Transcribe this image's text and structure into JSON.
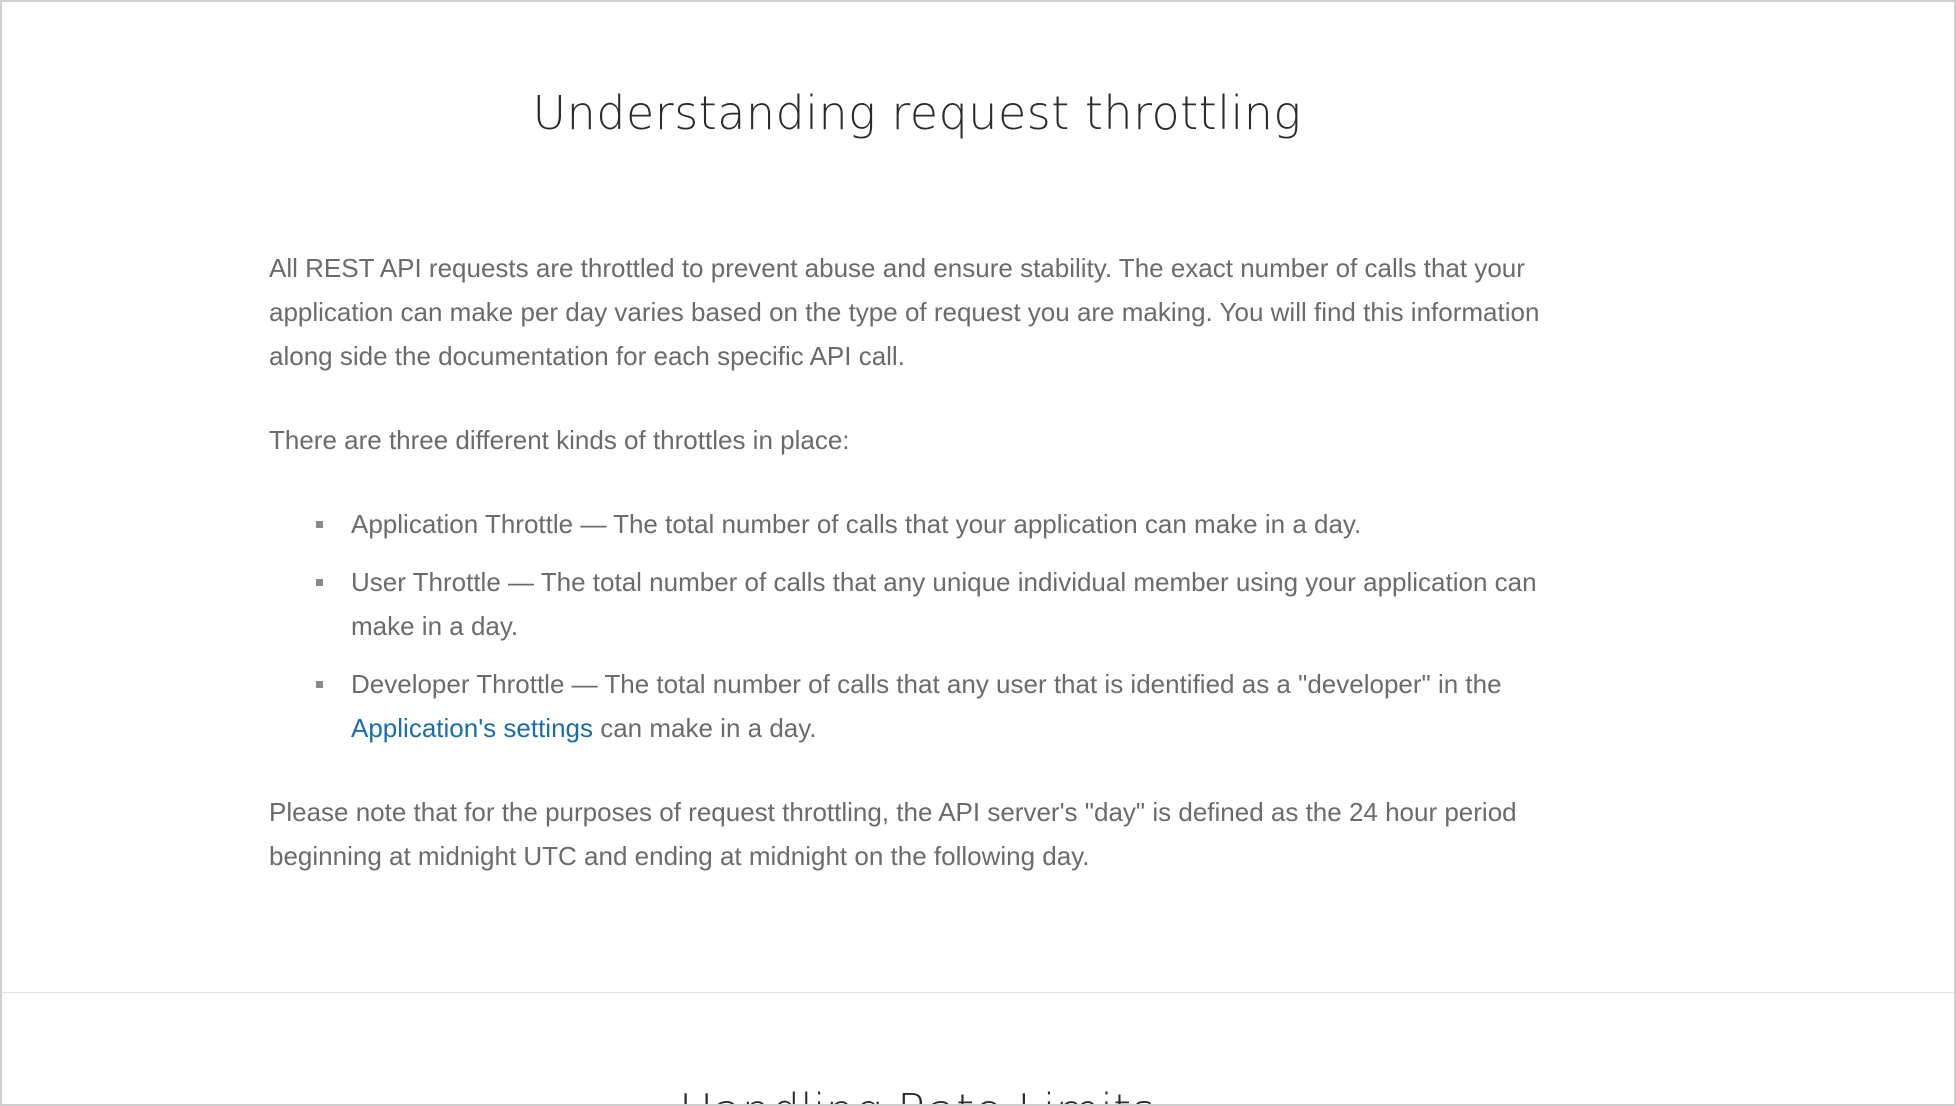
{
  "section": {
    "title": "Understanding request throttling",
    "paragraphs": {
      "intro": "All REST API requests are throttled to prevent abuse and ensure stability.  The exact number of calls that your application can make per day varies based on the type of request you are making.  You will find this information along side the documentation for each specific API call.",
      "kinds_intro": "There are three different kinds of throttles in place:",
      "note": "Please note that for the purposes of request throttling, the API server's \"day\" is defined as the 24 hour period beginning at midnight UTC and ending at midnight on the following day."
    },
    "throttles": [
      {
        "text": "Application Throttle — The total number of calls that your application can make in a day."
      },
      {
        "text": "User Throttle — The total number of calls that any unique individual member using your application can make in a day."
      },
      {
        "text_before": "Developer Throttle — The total number of calls that any user that is identified as a \"developer\" in the ",
        "link_label": "Application's settings",
        "text_after": " can make in a day."
      }
    ]
  },
  "next_section": {
    "title": "Handling Rate Limits"
  },
  "colors": {
    "title": "#2b2b2b",
    "body_text": "#6b6b6b",
    "link": "#1a6ea8",
    "bullet": "#8a8a8a",
    "divider": "#e3e3e3"
  },
  "icons": {
    "list_bullet": "square-bullet"
  }
}
